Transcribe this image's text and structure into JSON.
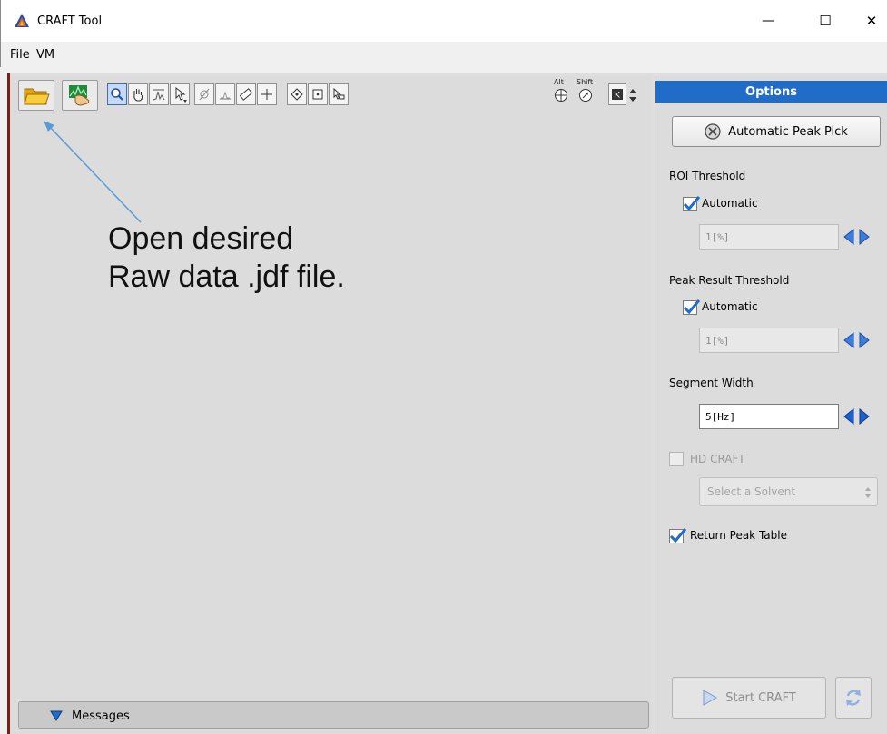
{
  "window": {
    "title": "CRAFT Tool",
    "minimize_symbol": "—",
    "maximize_symbol": "☐",
    "close_symbol": "✕"
  },
  "menu": {
    "items": [
      "File",
      "VM"
    ]
  },
  "toolbar": {
    "open_icon": "folder-open-icon",
    "process_icon": "spectrum-hand-icon",
    "tools": [
      "zoom-icon",
      "pan-hand-icon",
      "peak-icon",
      "pointer-icon",
      "phase-icon",
      "baseline-icon",
      "ruler-icon",
      "crosshair-icon",
      "diamond-icon",
      "square-dot-icon",
      "cursor-box-icon"
    ],
    "modifier_alt": "Alt",
    "modifier_shift": "Shift",
    "accent_color": "#1f6cc9"
  },
  "annotation": {
    "line1": "Open desired",
    "line2": "Raw data .jdf file."
  },
  "messages": {
    "label": "Messages"
  },
  "options": {
    "header": "Options",
    "auto_peak_pick_label": "Automatic Peak Pick",
    "roi_threshold": {
      "label": "ROI Threshold",
      "auto_label": "Automatic",
      "auto_checked": true,
      "value": "1[%]"
    },
    "peak_result_threshold": {
      "label": "Peak Result Threshold",
      "auto_label": "Automatic",
      "auto_checked": true,
      "value": "1[%]"
    },
    "segment_width": {
      "label": "Segment Width",
      "value": "5[Hz]"
    },
    "hd_craft": {
      "label": "HD CRAFT",
      "checked": false,
      "solvent_placeholder": "Select a Solvent"
    },
    "return_peak_table": {
      "label": "Return Peak Table",
      "checked": true
    },
    "start_label": "Start CRAFT"
  }
}
